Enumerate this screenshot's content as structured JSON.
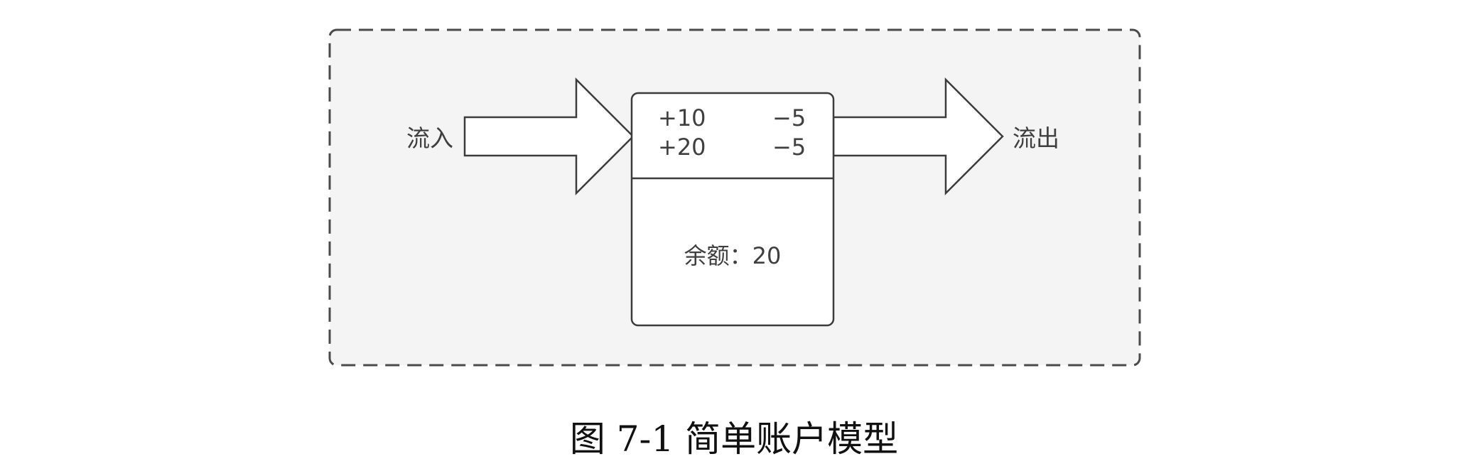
{
  "diagram": {
    "inflow_label": "流入",
    "outflow_label": "流出",
    "ledger": {
      "credits": [
        "+10",
        "+20"
      ],
      "debits": [
        "−5",
        "−5"
      ]
    },
    "balance_label": "余额：20"
  },
  "caption": "图 7-1  简单账户模型",
  "colors": {
    "panel_fill": "#f4f4f4",
    "panel_border": "#4a4a4a",
    "box_fill": "#ffffff",
    "stroke": "#3c3c3c",
    "text": "#3f3f3f"
  }
}
